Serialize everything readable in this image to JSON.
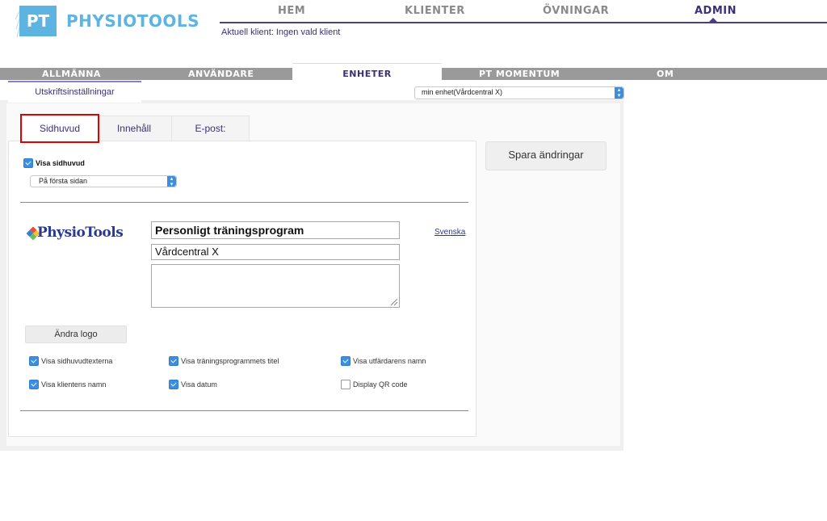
{
  "app": {
    "logo_abbr": "PT",
    "brand_name": "PHYSIOTOOLS",
    "brand_color": "#5eb4e0",
    "accent_color": "#3d2f7a"
  },
  "top_nav": {
    "items": [
      "HEM",
      "KLIENTER",
      "ÖVNINGAR",
      "ADMIN"
    ],
    "active": "ADMIN"
  },
  "current_client": "Aktuell klient: Ingen vald klient",
  "admin_tabs": {
    "items": [
      "ALLMÄNNA",
      "ANVÄNDARE",
      "ENHETER",
      "PT MOMENTUM",
      "OM"
    ],
    "active": "ENHETER"
  },
  "sub_tab": {
    "label": "Utskriftsinställningar"
  },
  "unit_select": {
    "value": "min enhet(Vårdcentral X)"
  },
  "inner_tabs": {
    "items": [
      "Sidhuvud",
      "Innehåll",
      "E-post:"
    ],
    "active": "Sidhuvud"
  },
  "save_button": "Spara ändringar",
  "header_settings": {
    "show_header": {
      "label": "Visa sidhuvud",
      "checked": true
    },
    "placement": {
      "value": "På första sidan"
    },
    "logo_text": "PhysioTools",
    "title_value": "Personligt träningsprogram",
    "org_value": "Vårdcentral X",
    "notes_value": "",
    "language_link": "Svenska",
    "change_logo": "Ändra logo",
    "options": [
      {
        "label": "Visa sidhuvudtexterna",
        "checked": true
      },
      {
        "label": "Visa träningsprogrammets titel",
        "checked": true
      },
      {
        "label": "Visa utfärdarens namn",
        "checked": true
      },
      {
        "label": "Visa klientens namn",
        "checked": true
      },
      {
        "label": "Visa datum",
        "checked": true
      },
      {
        "label": "Display QR code",
        "checked": false
      }
    ]
  }
}
